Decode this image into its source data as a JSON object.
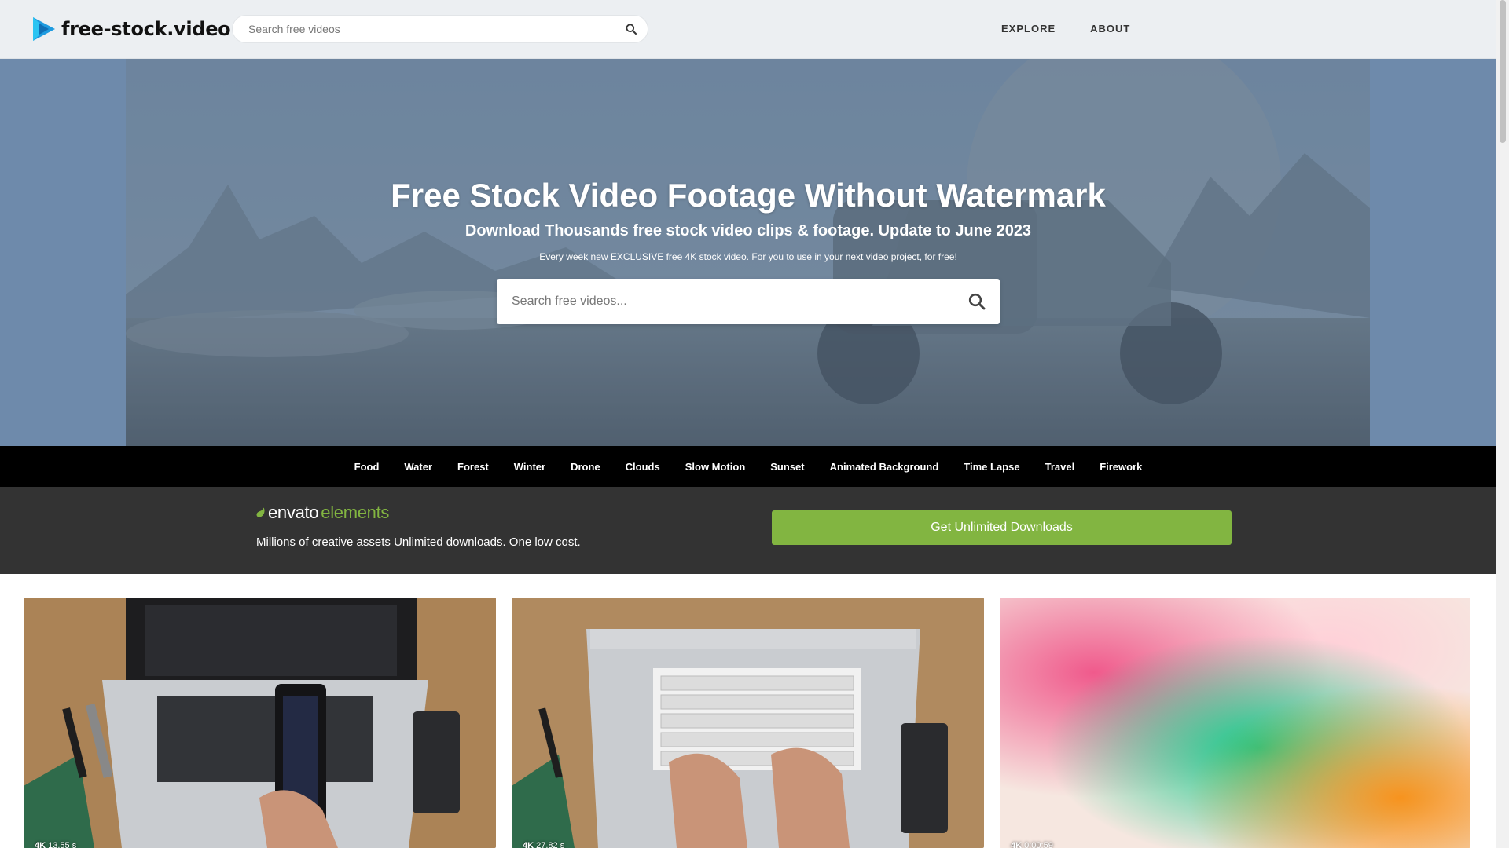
{
  "site": {
    "name": "free-stock.video"
  },
  "header": {
    "search_placeholder": "Search free videos",
    "nav": [
      "EXPLORE",
      "ABOUT"
    ]
  },
  "hero": {
    "title": "Free Stock Video Footage Without Watermark",
    "subtitle": "Download Thousands free stock video clips & footage. Update to June 2023",
    "note": "Every week new EXCLUSIVE free 4K stock video. For you to use in your next video project, for free!",
    "search_placeholder": "Search free videos..."
  },
  "categories": [
    "Food",
    "Water",
    "Forest",
    "Winter",
    "Drone",
    "Clouds",
    "Slow Motion",
    "Sunset",
    "Animated Background",
    "Time Lapse",
    "Travel",
    "Firework"
  ],
  "promo": {
    "brand_name": "envato",
    "brand_suffix": "elements",
    "tagline": "Millions of creative assets Unlimited downloads. One low cost.",
    "button_label": "Get Unlimited Downloads",
    "accent_color": "#82b541"
  },
  "videos": [
    {
      "quality": "4K",
      "duration": "13.55 s"
    },
    {
      "quality": "4K",
      "duration": "27.82 s"
    },
    {
      "quality": "4K",
      "duration": "0:00:59"
    }
  ],
  "colors": {
    "topbar_bg": "#eceff2",
    "hero_band": "#6e8aab",
    "category_bar": "#000000",
    "promo_bg": "#333333"
  },
  "icons": {
    "logo": "play-triangle-icon",
    "search": "search-icon",
    "envato": "leaf-icon"
  }
}
